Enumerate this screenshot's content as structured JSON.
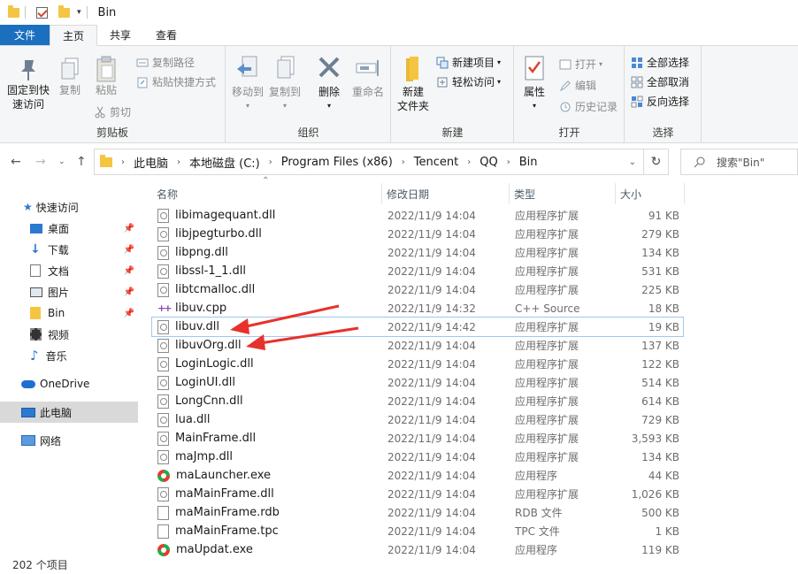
{
  "window": {
    "title": "Bin"
  },
  "tabs": [
    {
      "label": "文件"
    },
    {
      "label": "主页"
    },
    {
      "label": "共享"
    },
    {
      "label": "查看"
    }
  ],
  "ribbon": {
    "clipboard": {
      "label": "剪贴板",
      "pin_quick": "固定到快\n速访问",
      "pin_quick_1": "固定到快",
      "pin_quick_2": "速访问",
      "copy": "复制",
      "paste": "粘贴",
      "copy_path": "复制路径",
      "paste_shortcut": "粘贴快捷方式",
      "cut": "剪切"
    },
    "organize": {
      "label": "组织",
      "move_to": "移动到",
      "copy_to": "复制到",
      "delete": "删除",
      "rename": "重命名"
    },
    "new": {
      "label": "新建",
      "new_folder_1": "新建",
      "new_folder_2": "文件夹",
      "new_item": "新建项目",
      "easy_access": "轻松访问"
    },
    "open": {
      "label": "打开",
      "properties": "属性",
      "open": "打开",
      "edit": "编辑",
      "history": "历史记录"
    },
    "select": {
      "label": "选择",
      "select_all": "全部选择",
      "select_none": "全部取消",
      "invert": "反向选择"
    }
  },
  "address": {
    "crumbs": [
      "此电脑",
      "本地磁盘 (C:)",
      "Program Files (x86)",
      "Tencent",
      "QQ",
      "Bin"
    ],
    "search_placeholder": "搜索\"Bin\""
  },
  "nav": {
    "items": [
      {
        "label": "快速访问"
      },
      {
        "label": "桌面"
      },
      {
        "label": "下载"
      },
      {
        "label": "文档"
      },
      {
        "label": "图片"
      },
      {
        "label": "Bin"
      },
      {
        "label": "视频"
      },
      {
        "label": "音乐"
      },
      {
        "label": "OneDrive"
      },
      {
        "label": "此电脑"
      },
      {
        "label": "网络"
      }
    ]
  },
  "columns": {
    "name": "名称",
    "date": "修改日期",
    "type": "类型",
    "size": "大小"
  },
  "files": [
    {
      "name": "libimagequant.dll",
      "date": "2022/11/9 14:04",
      "type": "应用程序扩展",
      "size": "91 KB",
      "icon": "dll"
    },
    {
      "name": "libjpegturbo.dll",
      "date": "2022/11/9 14:04",
      "type": "应用程序扩展",
      "size": "279 KB",
      "icon": "dll"
    },
    {
      "name": "libpng.dll",
      "date": "2022/11/9 14:04",
      "type": "应用程序扩展",
      "size": "134 KB",
      "icon": "dll"
    },
    {
      "name": "libssl-1_1.dll",
      "date": "2022/11/9 14:04",
      "type": "应用程序扩展",
      "size": "531 KB",
      "icon": "dll"
    },
    {
      "name": "libtcmalloc.dll",
      "date": "2022/11/9 14:04",
      "type": "应用程序扩展",
      "size": "225 KB",
      "icon": "dll"
    },
    {
      "name": "libuv.cpp",
      "date": "2022/11/9 14:32",
      "type": "C++ Source",
      "size": "18 KB",
      "icon": "cpp"
    },
    {
      "name": "libuv.dll",
      "date": "2022/11/9 14:42",
      "type": "应用程序扩展",
      "size": "19 KB",
      "icon": "dll"
    },
    {
      "name": "libuvOrg.dll",
      "date": "2022/11/9 14:04",
      "type": "应用程序扩展",
      "size": "137 KB",
      "icon": "dll"
    },
    {
      "name": "LoginLogic.dll",
      "date": "2022/11/9 14:04",
      "type": "应用程序扩展",
      "size": "122 KB",
      "icon": "dll"
    },
    {
      "name": "LoginUI.dll",
      "date": "2022/11/9 14:04",
      "type": "应用程序扩展",
      "size": "514 KB",
      "icon": "dll"
    },
    {
      "name": "LongCnn.dll",
      "date": "2022/11/9 14:04",
      "type": "应用程序扩展",
      "size": "614 KB",
      "icon": "dll"
    },
    {
      "name": "lua.dll",
      "date": "2022/11/9 14:04",
      "type": "应用程序扩展",
      "size": "729 KB",
      "icon": "dll"
    },
    {
      "name": "MainFrame.dll",
      "date": "2022/11/9 14:04",
      "type": "应用程序扩展",
      "size": "3,593 KB",
      "icon": "dll"
    },
    {
      "name": "maJmp.dll",
      "date": "2022/11/9 14:04",
      "type": "应用程序扩展",
      "size": "134 KB",
      "icon": "dll"
    },
    {
      "name": "maLauncher.exe",
      "date": "2022/11/9 14:04",
      "type": "应用程序",
      "size": "44 KB",
      "icon": "exe"
    },
    {
      "name": "maMainFrame.dll",
      "date": "2022/11/9 14:04",
      "type": "应用程序扩展",
      "size": "1,026 KB",
      "icon": "dll"
    },
    {
      "name": "maMainFrame.rdb",
      "date": "2022/11/9 14:04",
      "type": "RDB 文件",
      "size": "500 KB",
      "icon": "blank"
    },
    {
      "name": "maMainFrame.tpc",
      "date": "2022/11/9 14:04",
      "type": "TPC 文件",
      "size": "1 KB",
      "icon": "blank"
    },
    {
      "name": "maUpdat.exe",
      "date": "2022/11/9 14:04",
      "type": "应用程序",
      "size": "119 KB",
      "icon": "exe"
    }
  ],
  "status": {
    "count": "202 个项目"
  },
  "colors": {
    "accent": "#1a6fbf",
    "arrow": "#e8312a",
    "folder": "#f5c542"
  }
}
